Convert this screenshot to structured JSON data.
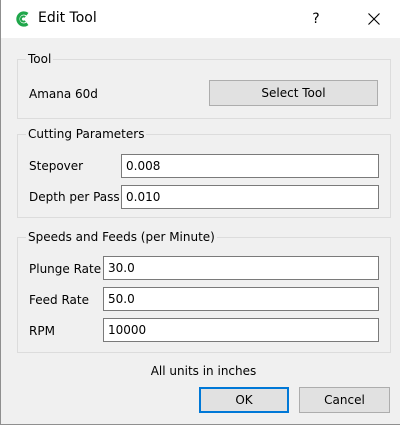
{
  "window": {
    "title": "Edit Tool",
    "help_label": "?",
    "accent_color": "#0078d7",
    "brand_color": "#1fa64a"
  },
  "tool": {
    "group_title": "Tool",
    "tool_name": "Amana 60d",
    "select_button_label": "Select Tool"
  },
  "cutting": {
    "group_title": "Cutting Parameters",
    "stepover_label": "Stepover",
    "stepover_value": "0.008",
    "depth_label": "Depth per Pass",
    "depth_value": "0.010"
  },
  "speeds": {
    "group_title": "Speeds and Feeds (per Minute)",
    "plunge_label": "Plunge Rate",
    "plunge_value": "30.0",
    "feed_label": "Feed Rate",
    "feed_value": "50.0",
    "rpm_label": "RPM",
    "rpm_value": "10000"
  },
  "footer": {
    "units_note": "All units in inches",
    "ok_label": "OK",
    "cancel_label": "Cancel"
  }
}
